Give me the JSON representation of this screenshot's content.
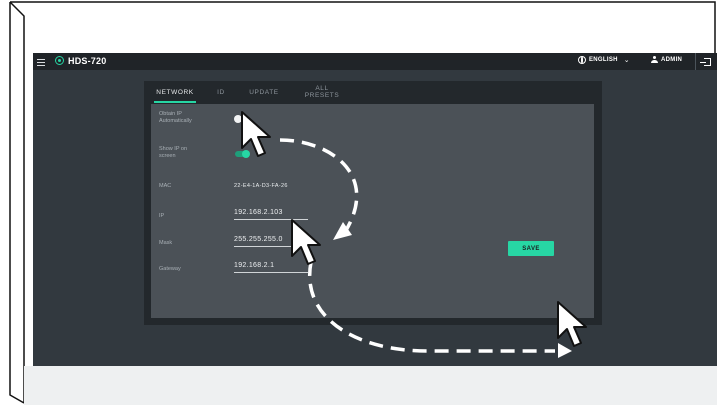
{
  "header": {
    "model": "HDS-720",
    "language": "ENGLISH",
    "user": "ADMIN"
  },
  "tabs": [
    {
      "label": "NETWORK",
      "active": true
    },
    {
      "label": "ID",
      "active": false
    },
    {
      "label": "UPDATE",
      "active": false
    },
    {
      "label": "ALL PRESETS",
      "active": false
    }
  ],
  "settings": {
    "obtain_ip": {
      "label": "Obtain IP Automatically",
      "on": false
    },
    "show_ip": {
      "label": "Show IP on screen",
      "on": true
    },
    "mac": {
      "label": "MAC",
      "value": "22-E4-1A-D3-FA-26"
    },
    "ip": {
      "label": "IP",
      "value": "192.168.2.103"
    },
    "mask": {
      "label": "Mask",
      "value": "255.255.255.0"
    },
    "gateway": {
      "label": "Gateway",
      "value": "192.168.2.1"
    }
  },
  "save_label": "SAVE",
  "colors": {
    "accent": "#27d6a4",
    "topbar": "#202428",
    "app_bg": "#32393f",
    "panel": "#4b5157"
  }
}
